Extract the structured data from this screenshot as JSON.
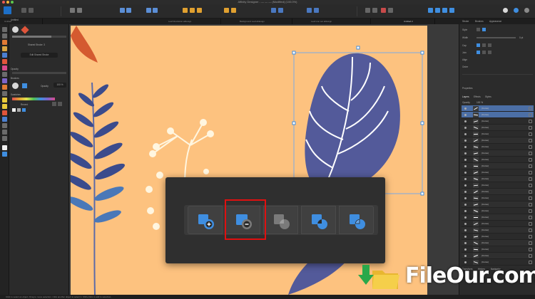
{
  "window": {
    "title": "Affinity Designer - — — — (Modified) (100.0%)"
  },
  "tabs": [
    "Untitled",
    "Leaf illustration.afdesign",
    "Background Leaf.afdesign",
    "Leaf icon set.afdesign",
    "Untitled 2"
  ],
  "left_panel": {
    "persona": "Untitled",
    "stroke_label": "Stroke",
    "stroke_value": "Shared Stroke: 3",
    "style_button": "Edit Shared Stroke",
    "section_brush": "Brushes",
    "section_opacity": "Opacity",
    "opacity_value": "100 %",
    "section_swatches": "Swatches",
    "swatch_set": "Recent"
  },
  "right_panel": {
    "tabs": [
      "Stroke",
      "Brushes",
      "Appearance"
    ],
    "stroke_rows": [
      "Style",
      "Width",
      "Cap",
      "Join",
      "Align",
      "Order"
    ],
    "width_value": "0 pt",
    "section_properties": "Properties",
    "layers_tabs": [
      "Layers",
      "Effects",
      "Styles"
    ],
    "opacity_label": "Opacity",
    "opacity_value": "100 %",
    "layers": [
      {
        "name": "(Curve)",
        "selected": true
      },
      {
        "name": "(Curve)",
        "selected": true
      },
      {
        "name": "(Curve)",
        "selected": false
      },
      {
        "name": "(Curve)",
        "selected": false
      },
      {
        "name": "(Curve)",
        "selected": false
      },
      {
        "name": "(Curve)",
        "selected": false
      },
      {
        "name": "(Curve)",
        "selected": false
      },
      {
        "name": "(Curve)",
        "selected": false
      },
      {
        "name": "(Curve)",
        "selected": false
      },
      {
        "name": "(Curve)",
        "selected": false
      },
      {
        "name": "(Curve)",
        "selected": false
      },
      {
        "name": "(Curve)",
        "selected": false
      },
      {
        "name": "(Curve)",
        "selected": false
      },
      {
        "name": "(Curve)",
        "selected": false
      },
      {
        "name": "(Curve)",
        "selected": false
      },
      {
        "name": "(Curve)",
        "selected": false
      },
      {
        "name": "(Curve)",
        "selected": false
      },
      {
        "name": "(Curve)",
        "selected": false
      },
      {
        "name": "(Curve)",
        "selected": false
      },
      {
        "name": "(Curve)",
        "selected": false
      },
      {
        "name": "(Curve)",
        "selected": false
      },
      {
        "name": "(Curve)",
        "selected": false
      },
      {
        "name": "(Curve)",
        "selected": false
      },
      {
        "name": "(Curve)",
        "selected": false
      },
      {
        "name": "(Curve)",
        "selected": false
      }
    ],
    "bottom_tabs": [
      "Transform",
      "History",
      "Navigator"
    ]
  },
  "boolean_ops": [
    {
      "op": "add",
      "icon": "boolean-add-icon"
    },
    {
      "op": "subtract",
      "icon": "boolean-subtract-icon",
      "highlighted": true
    },
    {
      "op": "intersect",
      "icon": "boolean-intersect-icon"
    },
    {
      "op": "xor",
      "icon": "boolean-xor-icon"
    },
    {
      "op": "divide",
      "icon": "boolean-divide-icon"
    }
  ],
  "statusbar": {
    "text": "Click to select an object. Drag to move selection. Click another object to select it. Shift+Click to add to selection."
  },
  "watermark": {
    "text": "FileOur.com"
  },
  "colors": {
    "artboard": "#fdc27f",
    "leaf_blue": "#535a9a",
    "accent": "#3f8ee0",
    "highlight": "#e01010"
  }
}
